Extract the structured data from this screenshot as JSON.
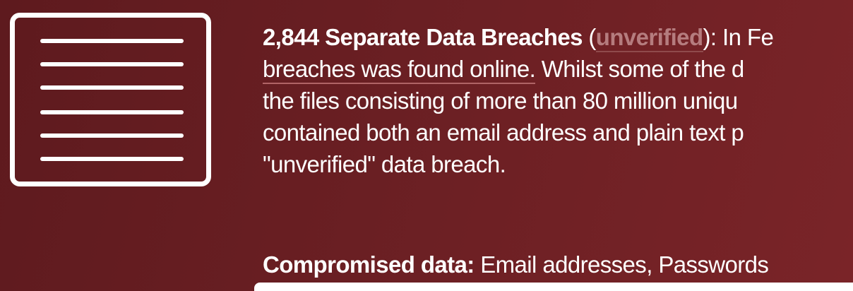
{
  "breach": {
    "icon": "document-lines-icon",
    "title": "2,844 Separate Data Breaches",
    "paren_open": " (",
    "verify_link": "unverified",
    "paren_close": "): In Fe",
    "line2_link": "breaches was found online.",
    "line2_rest": " Whilst some of the d",
    "line3": "the files consisting of more than 80 million uniqu",
    "line4": "contained both an email address and plain text p",
    "line5": "\"unverified\" data breach.",
    "compromised_label": "Compromised data:",
    "compromised_value": " Email addresses, Passwords"
  },
  "colors": {
    "background": "#6a1f23",
    "text": "#ffffff",
    "link_muted": "#b57c7e"
  }
}
